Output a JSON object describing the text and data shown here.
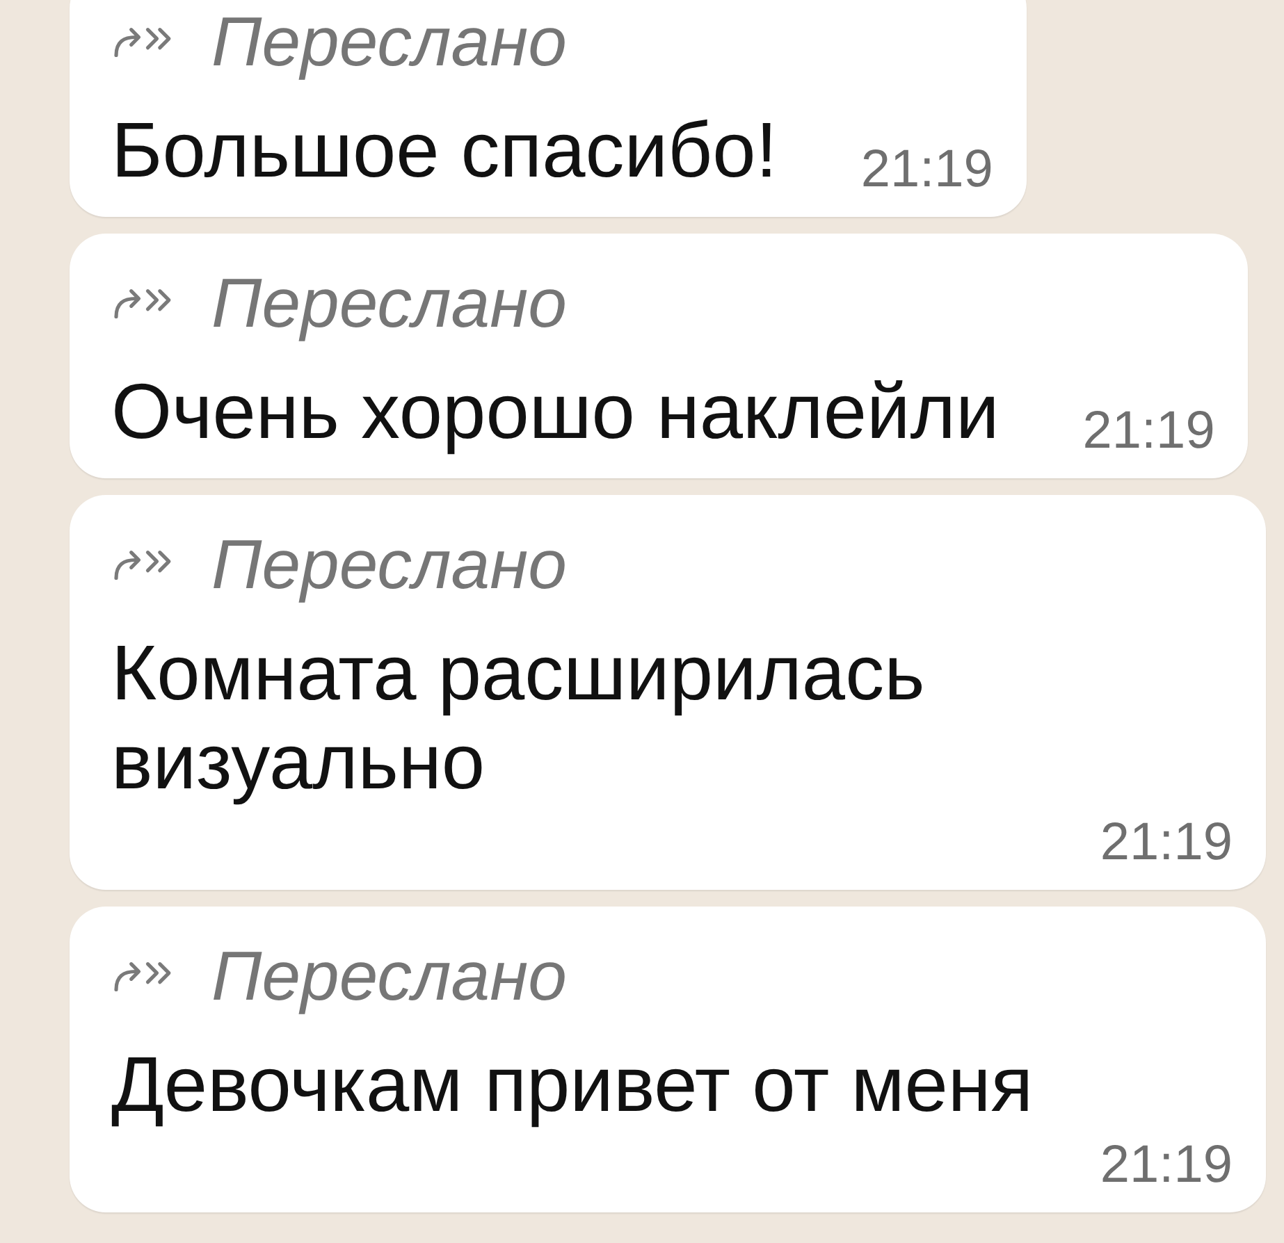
{
  "messages": [
    {
      "forwarded_label": "Переслано",
      "text": "Большое спасибо!",
      "time": "21:19"
    },
    {
      "forwarded_label": "Переслано",
      "text": "Очень хорошо наклейли",
      "time": "21:19"
    },
    {
      "forwarded_label": "Переслано",
      "text": "Комната расширилась визуально",
      "time": "21:19"
    },
    {
      "forwarded_label": "Переслано",
      "text": "Девочкам привет от меня",
      "time": "21:19"
    }
  ]
}
